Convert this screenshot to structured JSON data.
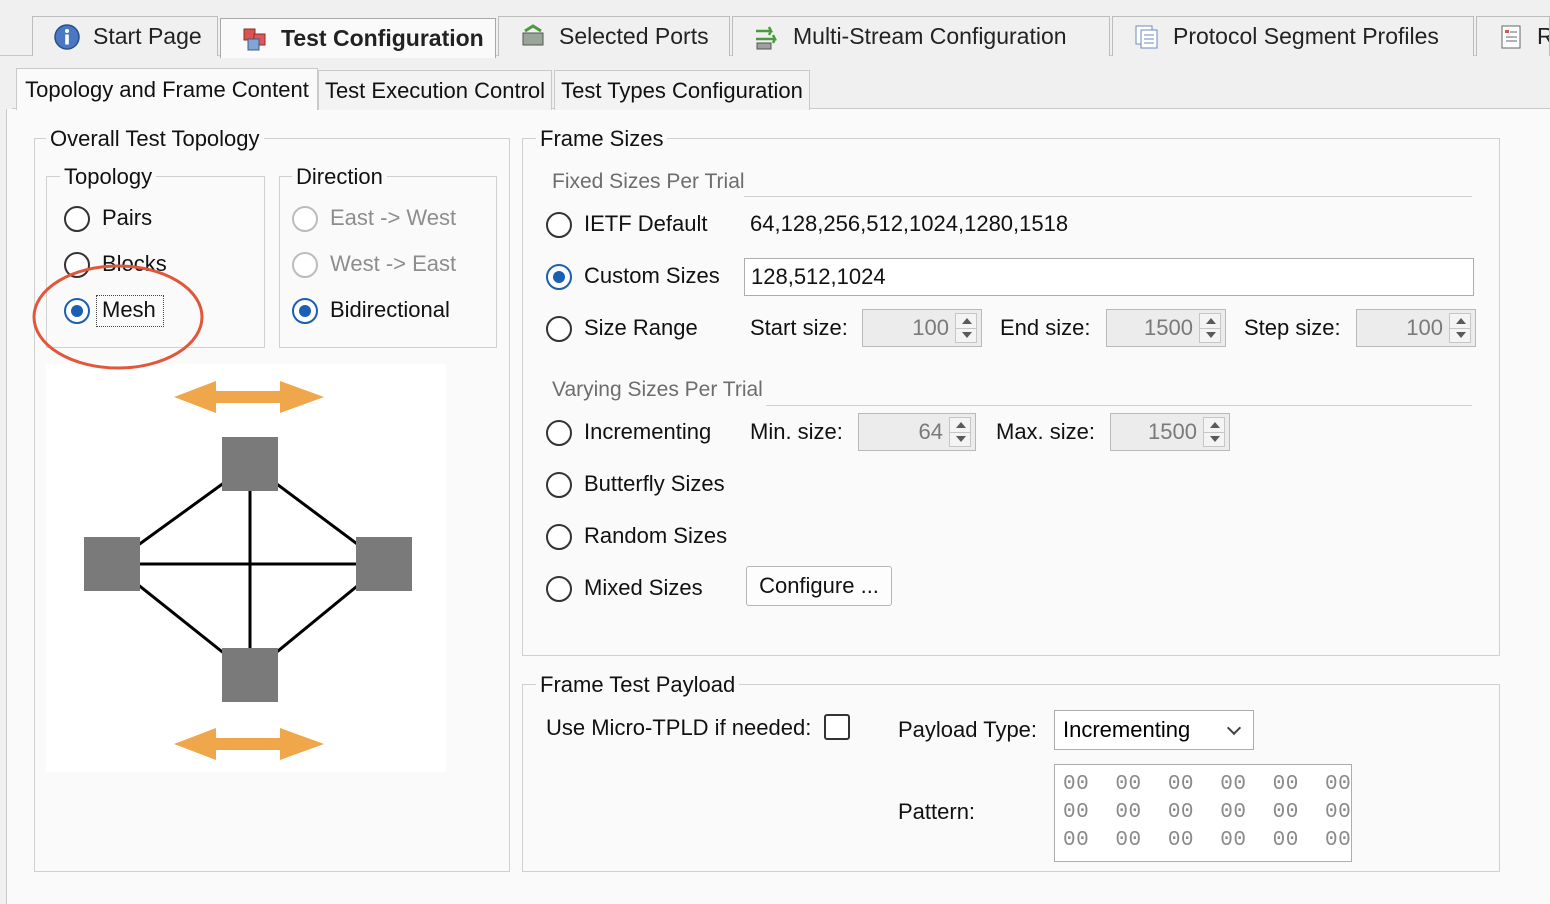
{
  "top_tabs": [
    {
      "label": "Start Page",
      "icon": "info-icon"
    },
    {
      "label": "Test Configuration",
      "icon": "config-cubes-icon",
      "active": true
    },
    {
      "label": "Selected Ports",
      "icon": "ports-icon"
    },
    {
      "label": "Multi-Stream Configuration",
      "icon": "multistream-icon"
    },
    {
      "label": "Protocol Segment Profiles",
      "icon": "profiles-icon"
    },
    {
      "label": "R",
      "icon": "report-icon"
    }
  ],
  "inner_tabs": [
    {
      "label": "Topology and Frame Content",
      "active": true
    },
    {
      "label": "Test Execution Control"
    },
    {
      "label": "Test Types Configuration"
    }
  ],
  "overall": {
    "title": "Overall Test Topology",
    "topology": {
      "title": "Topology",
      "options": [
        "Pairs",
        "Blocks",
        "Mesh"
      ],
      "selected": "Mesh"
    },
    "direction": {
      "title": "Direction",
      "options": [
        "East -> West",
        "West -> East",
        "Bidirectional"
      ],
      "selected": "Bidirectional"
    }
  },
  "frame_sizes": {
    "title": "Frame Sizes",
    "fixed_title": "Fixed Sizes Per Trial",
    "ietf_label": "IETF Default",
    "ietf_values": "64,128,256,512,1024,1280,1518",
    "custom_label": "Custom Sizes",
    "custom_value": "128,512,1024",
    "range_label": "Size Range",
    "start_label": "Start size:",
    "start_value": "100",
    "end_label": "End size:",
    "end_value": "1500",
    "step_label": "Step size:",
    "step_value": "100",
    "varying_title": "Varying Sizes Per Trial",
    "incrementing_label": "Incrementing",
    "min_label": "Min. size:",
    "min_value": "64",
    "max_label": "Max. size:",
    "max_value": "1500",
    "butterfly_label": "Butterfly Sizes",
    "random_label": "Random Sizes",
    "mixed_label": "Mixed Sizes",
    "configure_label": "Configure ...",
    "selected": "Custom Sizes"
  },
  "payload": {
    "title": "Frame Test Payload",
    "micro_tpld_label": "Use Micro-TPLD if needed:",
    "micro_tpld_checked": false,
    "type_label": "Payload Type:",
    "type_value": "Incrementing",
    "pattern_label": "Pattern:",
    "pattern_rows": [
      "00  00  00  00  00  00",
      "00  00  00  00  00  00",
      "00  00  00  00  00  00"
    ]
  },
  "colors": {
    "accent_blue": "#1a5fb4",
    "annotation_red": "#e0573a",
    "arrow_orange": "#f0a64a",
    "node_gray": "#7a7a7a"
  }
}
